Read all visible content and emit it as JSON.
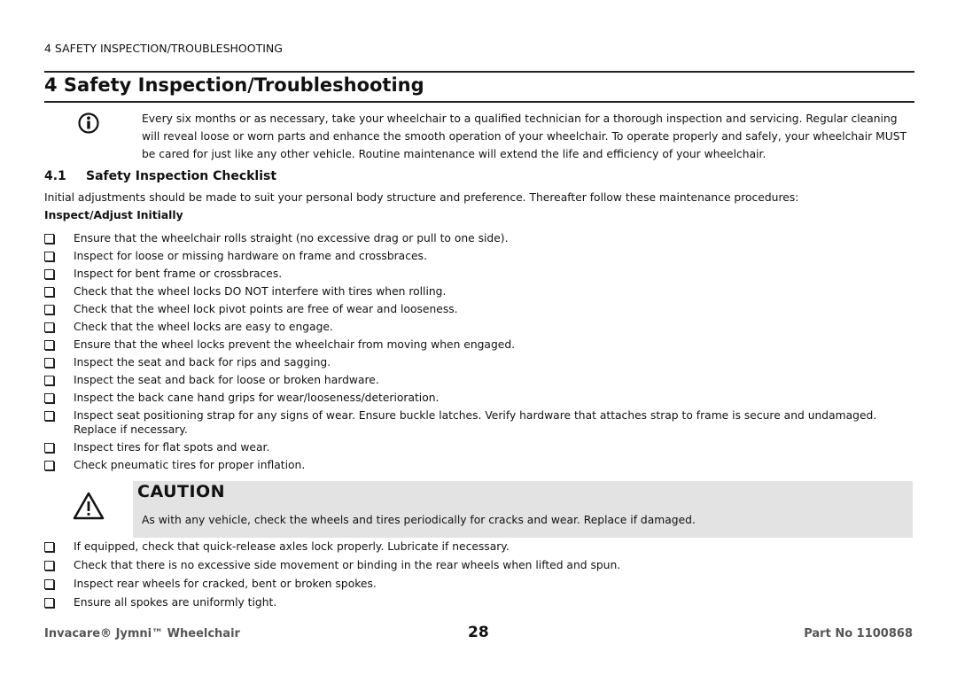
{
  "running_header": "4  SAFETY INSPECTION/TROUBLESHOOTING",
  "title": "4 Safety Inspection/Troubleshooting",
  "info_note": "Every six months or as necessary, take your wheelchair to a qualified technician for a thorough inspection and servicing. Regular cleaning will reveal loose or worn parts and enhance the smooth operation of your wheelchair. To operate properly and safely, your wheelchair MUST be cared for just like any other vehicle. Routine maintenance will extend the life and efficiency of your wheelchair.",
  "section": {
    "number": "4.1",
    "title": "Safety Inspection Checklist"
  },
  "intro": "Initial adjustments should be made to suit your personal body structure and preference. Thereafter follow these maintenance procedures:",
  "subhead": "Inspect/Adjust Initially",
  "checklist1": [
    "Ensure that the wheelchair rolls straight (no excessive drag or pull to one side).",
    "Inspect for loose or missing hardware on frame and crossbraces.",
    "Inspect for bent frame or crossbraces.",
    "Check that the wheel locks DO NOT interfere with tires when rolling.",
    "Check that the wheel lock pivot points are free of wear and looseness.",
    "Check that the wheel locks are easy to engage.",
    "Ensure that the wheel locks prevent the wheelchair from moving when engaged.",
    "Inspect the seat and back for rips and sagging.",
    "Inspect the seat and back for loose or broken hardware.",
    "Inspect the back cane hand grips for wear/looseness/deterioration.",
    "Inspect seat positioning strap for any signs of wear. Ensure buckle latches. Verify hardware that attaches strap to frame is secure and undamaged. Replace if necessary.",
    "Inspect tires for flat spots and wear.",
    "Check pneumatic tires for proper inflation."
  ],
  "caution": {
    "title": "CAUTION",
    "text": "As with any vehicle, check the wheels and tires periodically for cracks and wear. Replace if damaged.",
    "box_color": "#e3e3e3"
  },
  "checklist2": [
    "If equipped, check that quick-release axles lock properly. Lubricate if necessary.",
    "Check that there is no excessive side movement or binding in the rear wheels when lifted and spun.",
    "Inspect rear wheels for cracked, bent or broken spokes.",
    "Ensure all spokes are uniformly tight."
  ],
  "footer": {
    "left": "Invacare® Jymni™ Wheelchair",
    "page": "28",
    "right": "Part No 1100868"
  },
  "icons": {
    "info": "info-circle-icon",
    "warning": "warning-triangle-icon",
    "checkbox": "checkbox-icon"
  }
}
